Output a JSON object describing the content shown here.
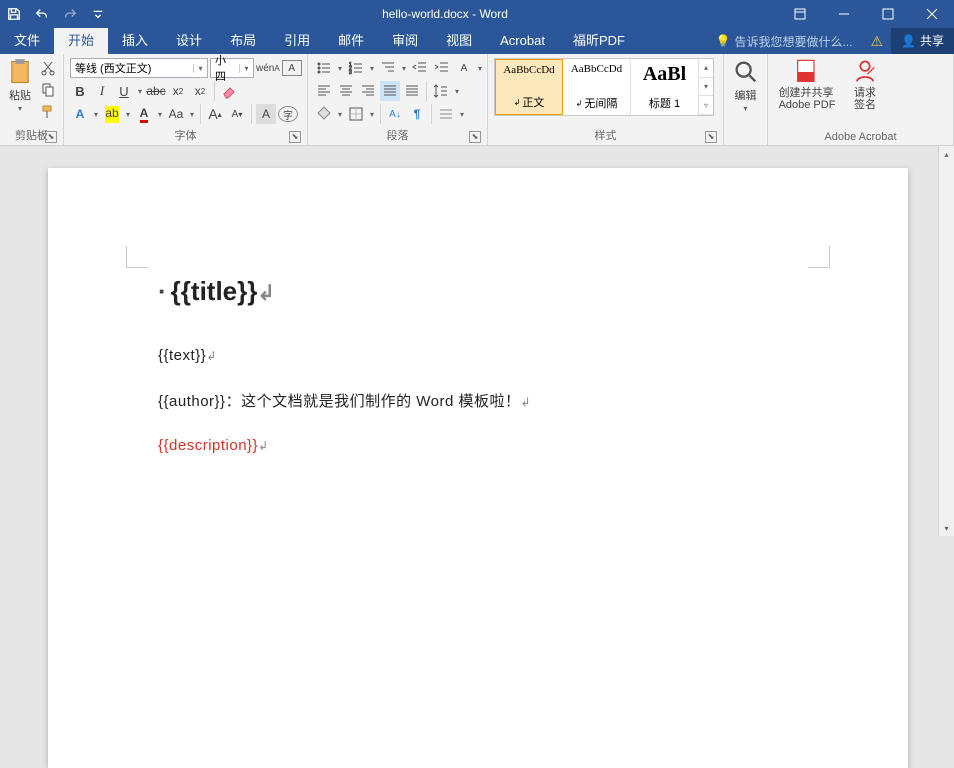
{
  "title_bar": {
    "document_title": "hello-world.docx - Word"
  },
  "tabs": {
    "file": "文件",
    "home": "开始",
    "insert": "插入",
    "design": "设计",
    "layout": "布局",
    "references": "引用",
    "mailings": "邮件",
    "review": "审阅",
    "view": "视图",
    "acrobat": "Acrobat",
    "foxit": "福昕PDF",
    "tell_me": "告诉我您想要做什么...",
    "share": "共享"
  },
  "ribbon": {
    "clipboard": {
      "label": "剪贴板",
      "paste": "粘贴"
    },
    "font": {
      "label": "字体",
      "font_name": "等线 (西文正文)",
      "font_size": "小四",
      "bold": "B",
      "italic": "I",
      "underline": "U",
      "strike": "abc",
      "sub": "x₂",
      "sup": "x²",
      "grow": "A",
      "shrink": "A",
      "case": "Aa",
      "clear": "A"
    },
    "paragraph": {
      "label": "段落"
    },
    "styles": {
      "label": "样式",
      "items": [
        {
          "preview": "AaBbCcDd",
          "name": "正文",
          "selected": true
        },
        {
          "preview": "AaBbCcDd",
          "name": "无间隔",
          "selected": false
        },
        {
          "preview": "AaBl",
          "name": "标题 1",
          "selected": false
        }
      ]
    },
    "editing": {
      "label": "编辑"
    },
    "adobe": {
      "label": "Adobe Acrobat",
      "create": "创建并共享\nAdobe PDF",
      "request": "请求\n签名"
    }
  },
  "document": {
    "title_line": "{{title}}",
    "text_line": "{{text}}",
    "author_line": "{{author}}：这个文档就是我们制作的 Word 模板啦！",
    "description_line": "{{description}}"
  }
}
